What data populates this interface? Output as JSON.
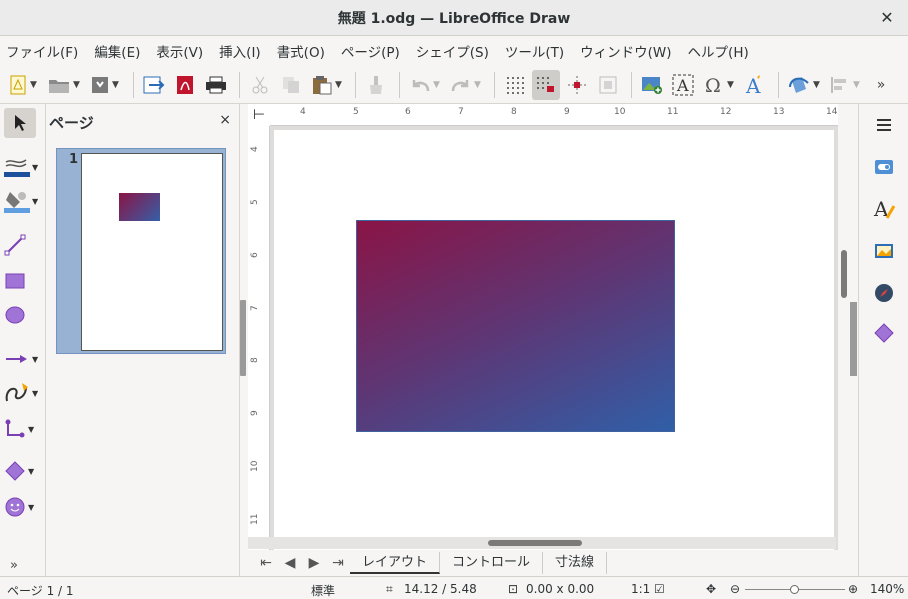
{
  "window": {
    "title": "無題 1.odg — LibreOffice Draw",
    "close_glyph": "✕"
  },
  "menu": [
    "ファイル(F)",
    "編集(E)",
    "表示(V)",
    "挿入(I)",
    "書式(O)",
    "ページ(P)",
    "シェイプ(S)",
    "ツール(T)",
    "ウィンドウ(W)",
    "ヘルプ(H)"
  ],
  "pages_pane": {
    "title": "ページ",
    "close_glyph": "×",
    "page_number": "1"
  },
  "ruler": {
    "h_ticks": [
      "4",
      "5",
      "6",
      "7",
      "8",
      "9",
      "10",
      "11",
      "12",
      "13",
      "14"
    ],
    "v_ticks": [
      "4",
      "5",
      "6",
      "7",
      "8",
      "9",
      "10",
      "11"
    ]
  },
  "tabs": {
    "items": [
      "レイアウト",
      "コントロール",
      "寸法線"
    ],
    "active": "レイアウト"
  },
  "status": {
    "page": "ページ 1 / 1",
    "style": "標準",
    "position": "14.12 / 5.48",
    "size": "0.00 x 0.00",
    "scale": "1:1",
    "zoom": "140%"
  },
  "colors": {
    "gradient_start": "#8a1446",
    "gradient_end": "#305fa8",
    "selection_bg": "#98b2d4"
  }
}
